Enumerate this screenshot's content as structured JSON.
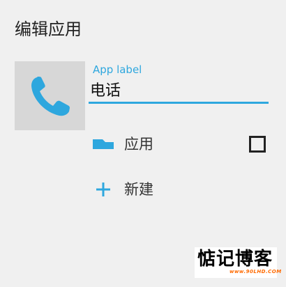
{
  "dialog": {
    "title": "编辑应用"
  },
  "app": {
    "icon": "phone-icon",
    "icon_bg": "#d7d7d7",
    "icon_color": "#2ea7de"
  },
  "label_field": {
    "hint": "App label",
    "value": "电话",
    "accent": "#2ea7de"
  },
  "rows": {
    "apps": {
      "icon": "folder-icon",
      "label": "应用",
      "checked": false
    },
    "new": {
      "icon": "plus-icon",
      "label": "新建"
    }
  },
  "watermark": {
    "title": "惦记博客",
    "url": "www.90LHD.COM"
  }
}
